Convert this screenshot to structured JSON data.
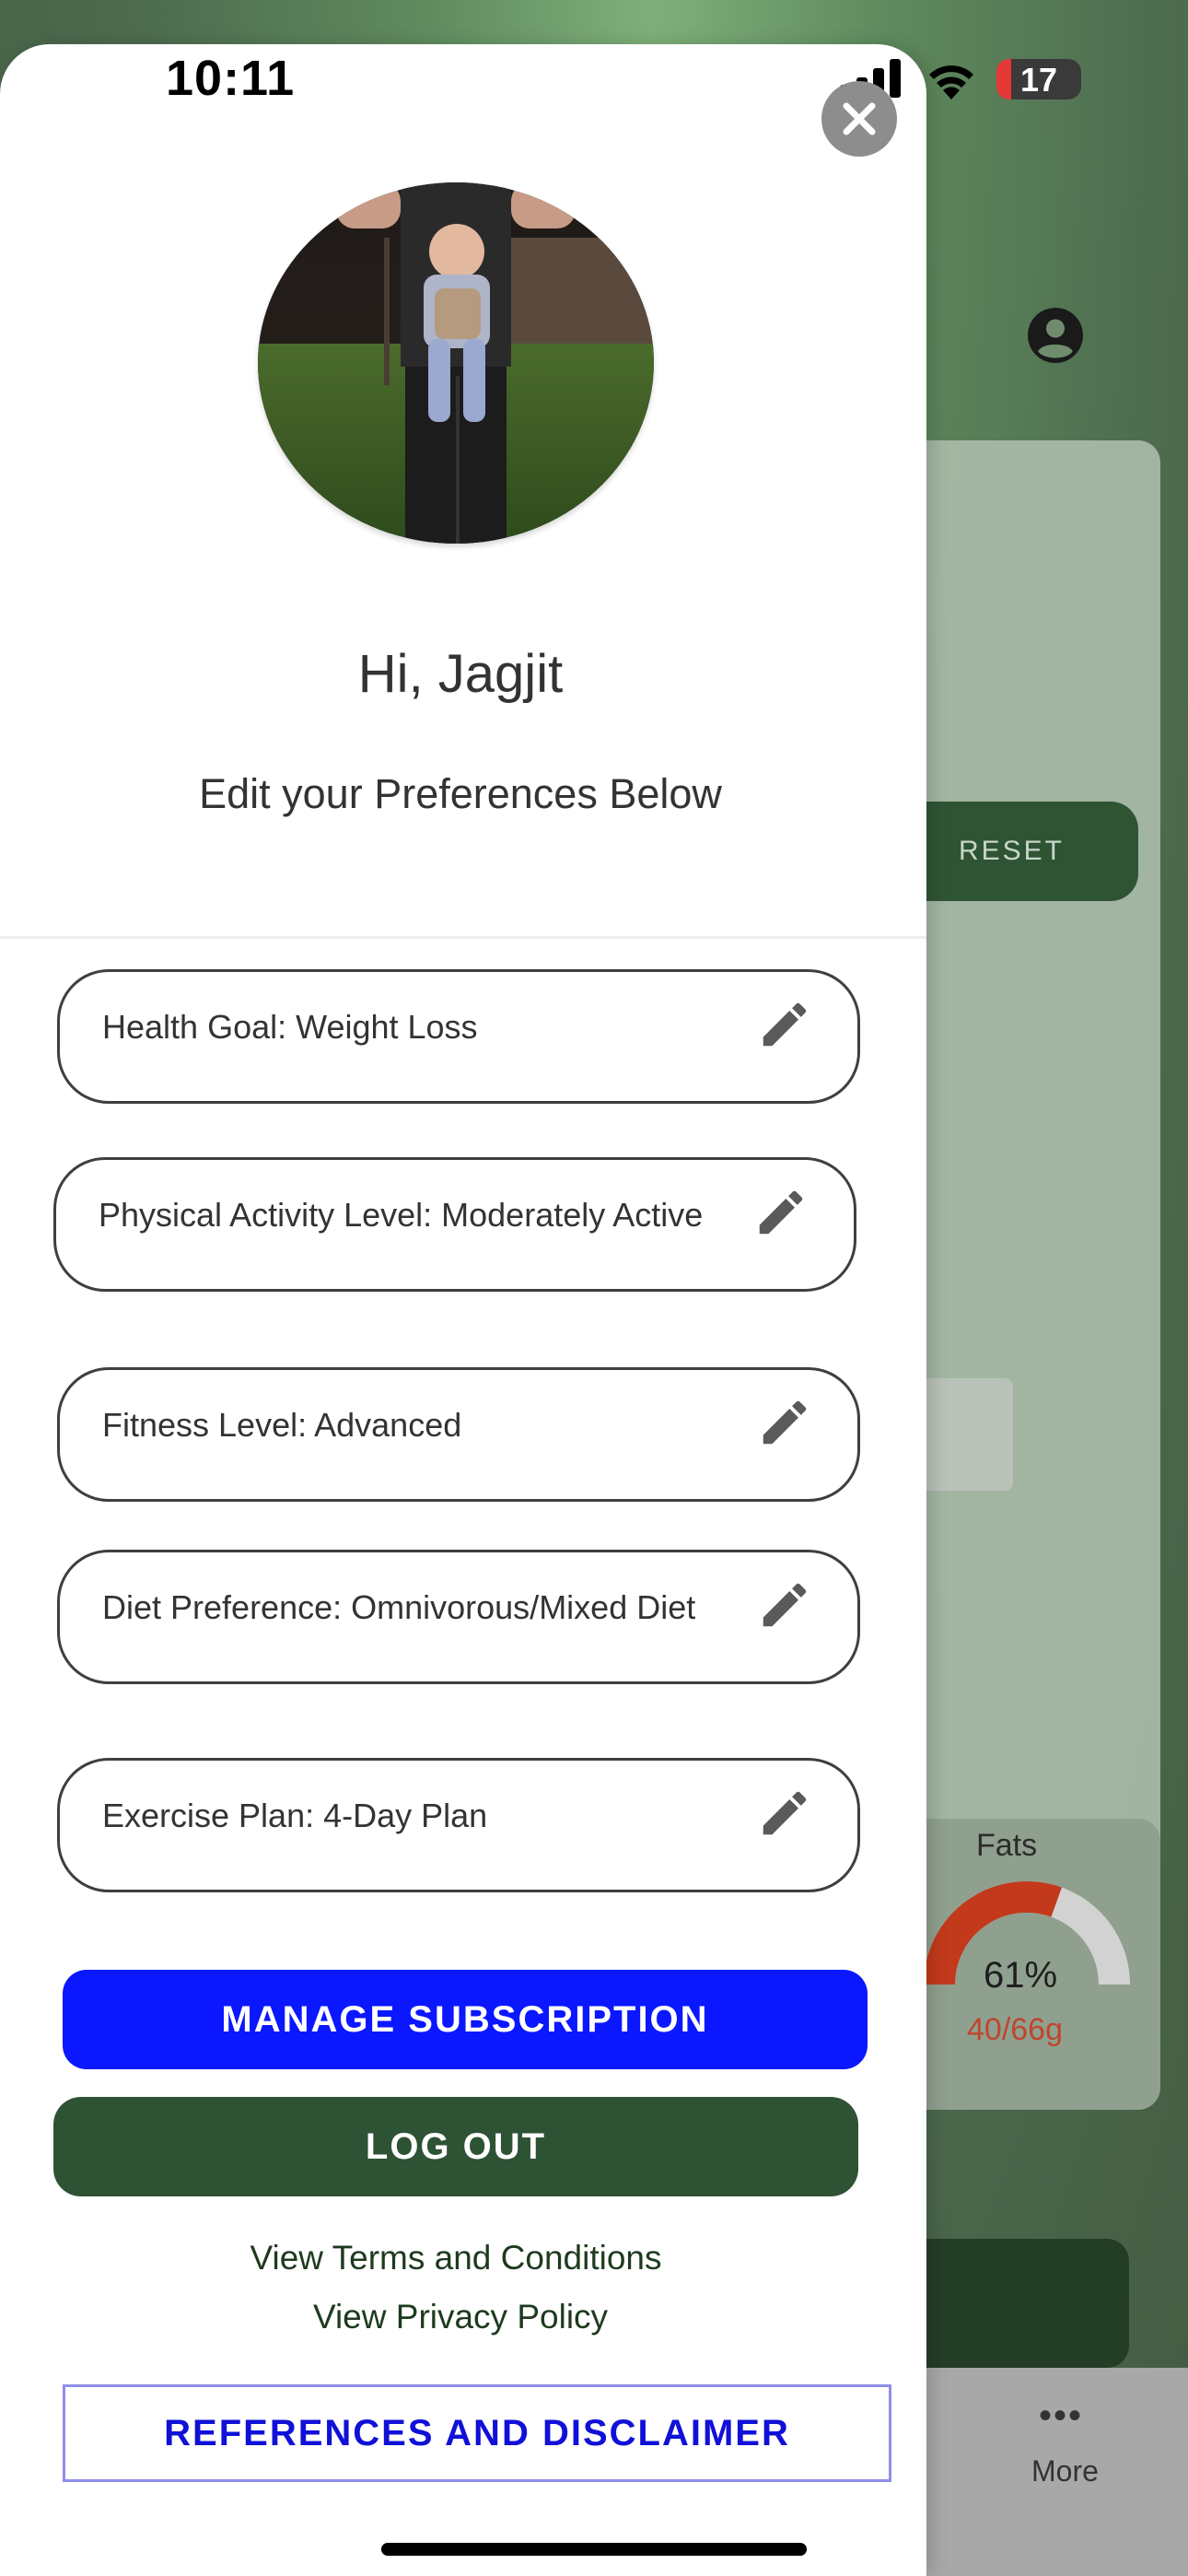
{
  "status_bar": {
    "time": "10:11",
    "battery": "17",
    "battery_level": 0.17
  },
  "background": {
    "reset_label": "RESET",
    "fats": {
      "title": "Fats",
      "percent": "61%",
      "value": "40/66g",
      "fraction": 0.61
    },
    "tab_more_icon": "•••",
    "tab_more_label": "More"
  },
  "drawer": {
    "greeting": "Hi, Jagjit",
    "subtitle": "Edit your Preferences Below",
    "preferences": [
      {
        "label": "Health Goal: Weight Loss",
        "icon": "pencil-icon"
      },
      {
        "label": "Physical Activity Level: Moderately Active",
        "icon": "pencil-icon"
      },
      {
        "label": "Fitness Level: Advanced",
        "icon": "pencil-icon"
      },
      {
        "label": "Diet Preference: Omnivorous/Mixed Diet",
        "icon": "pencil-icon"
      },
      {
        "label": "Exercise Plan: 4-Day Plan",
        "icon": "pencil-icon"
      }
    ],
    "manage_subscription": "MANAGE SUBSCRIPTION",
    "log_out": "LOG OUT",
    "terms_link": "View Terms and Conditions",
    "privacy_link": "View Privacy Policy",
    "references": "REFERENCES AND DISCLAIMER"
  },
  "colors": {
    "manage_button": "#0a17ff",
    "logout_button": "#2e5234",
    "references_text": "#1010d8",
    "fats_value": "#c0452e"
  }
}
